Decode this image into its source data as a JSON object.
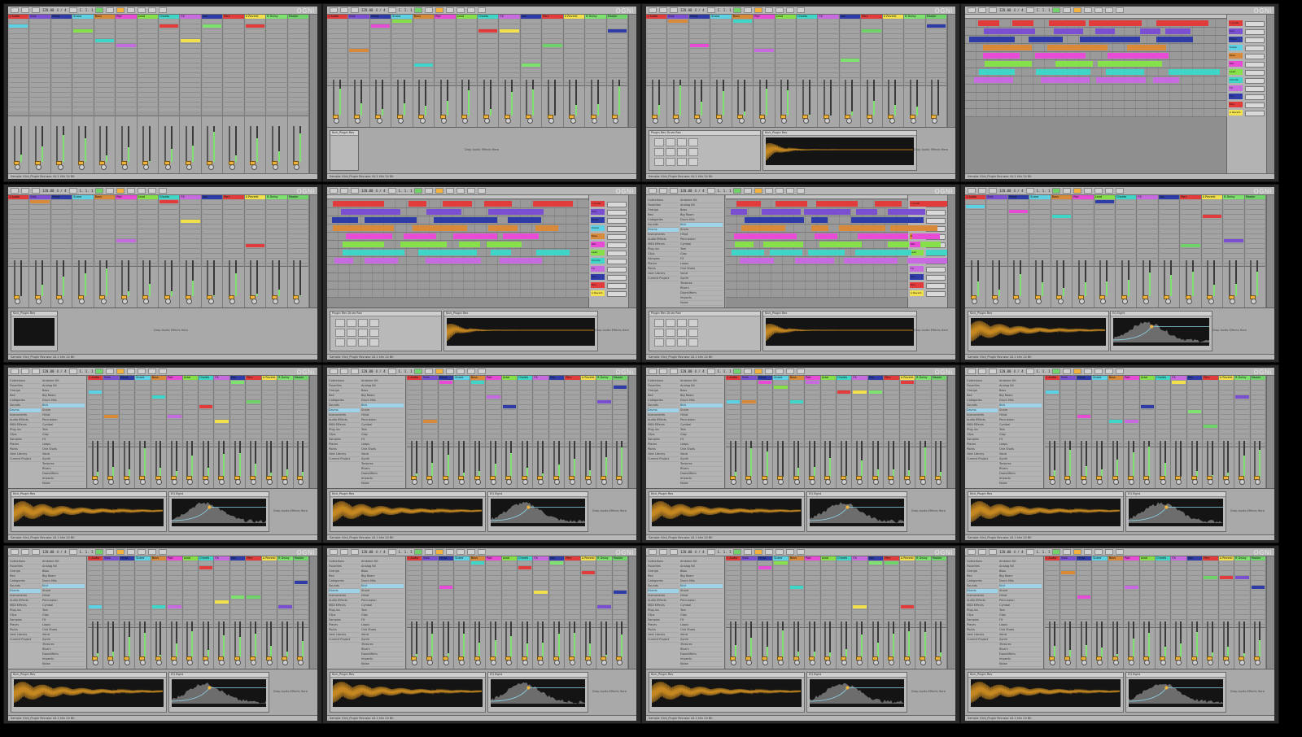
{
  "watermark": "OGNi",
  "transport": {
    "tempo": "120.00",
    "meter": "4 / 4",
    "position": "1. 1. 1"
  },
  "track_labels": [
    "1 Audio",
    "Kick",
    "Hihat",
    "Snare",
    "Bass",
    "Pad",
    "Lead",
    "Chords",
    "FX",
    "Vox",
    "Perc",
    "A Reverb",
    "B Delay",
    "Master"
  ],
  "track_colors": [
    "#e23b3b",
    "#7b4fd1",
    "#2f3ca8",
    "#5bd1e3",
    "#d88a3a",
    "#e84bd6",
    "#86e04a",
    "#3fd6c8",
    "#c86be0",
    "#2f3ca8",
    "#e23b3b",
    "#f2e14d",
    "#7de36e",
    "#6fd36a"
  ],
  "browser_places": [
    "Collections",
    "Favorites",
    "Orange",
    "Red",
    "Categories",
    "Sounds",
    "Drums",
    "Instruments",
    "Audio Effects",
    "MIDI Effects",
    "Plug-ins",
    "Clips",
    "Samples",
    "Places",
    "Packs",
    "User Library",
    "Current Project"
  ],
  "browser_items": [
    "Ambient Kit",
    "Analog Kit",
    "Bass",
    "Big Room",
    "Drum Hits",
    "Kick",
    "Snare",
    "Hihat",
    "Percussion",
    "Cymbal",
    "Tom",
    "Clap",
    "FX",
    "Loops",
    "One Shots",
    "Vocal",
    "Synth",
    "Textures",
    "Risers",
    "Downlifters",
    "Impacts",
    "Noise"
  ],
  "devices": {
    "simpler_title": "Kick_Plugin Rev",
    "eq_title": "EQ Eight",
    "drum_rack_title": "Plugin Rev Drum Rev",
    "drop_hint": "Drop Audio Effects Here",
    "drop_instrument_hint": "Drop an Instrument or Sample Here"
  },
  "status": "Sample: Kick_Plugin Rev.wav  44.1 kHz  24 Bit"
}
